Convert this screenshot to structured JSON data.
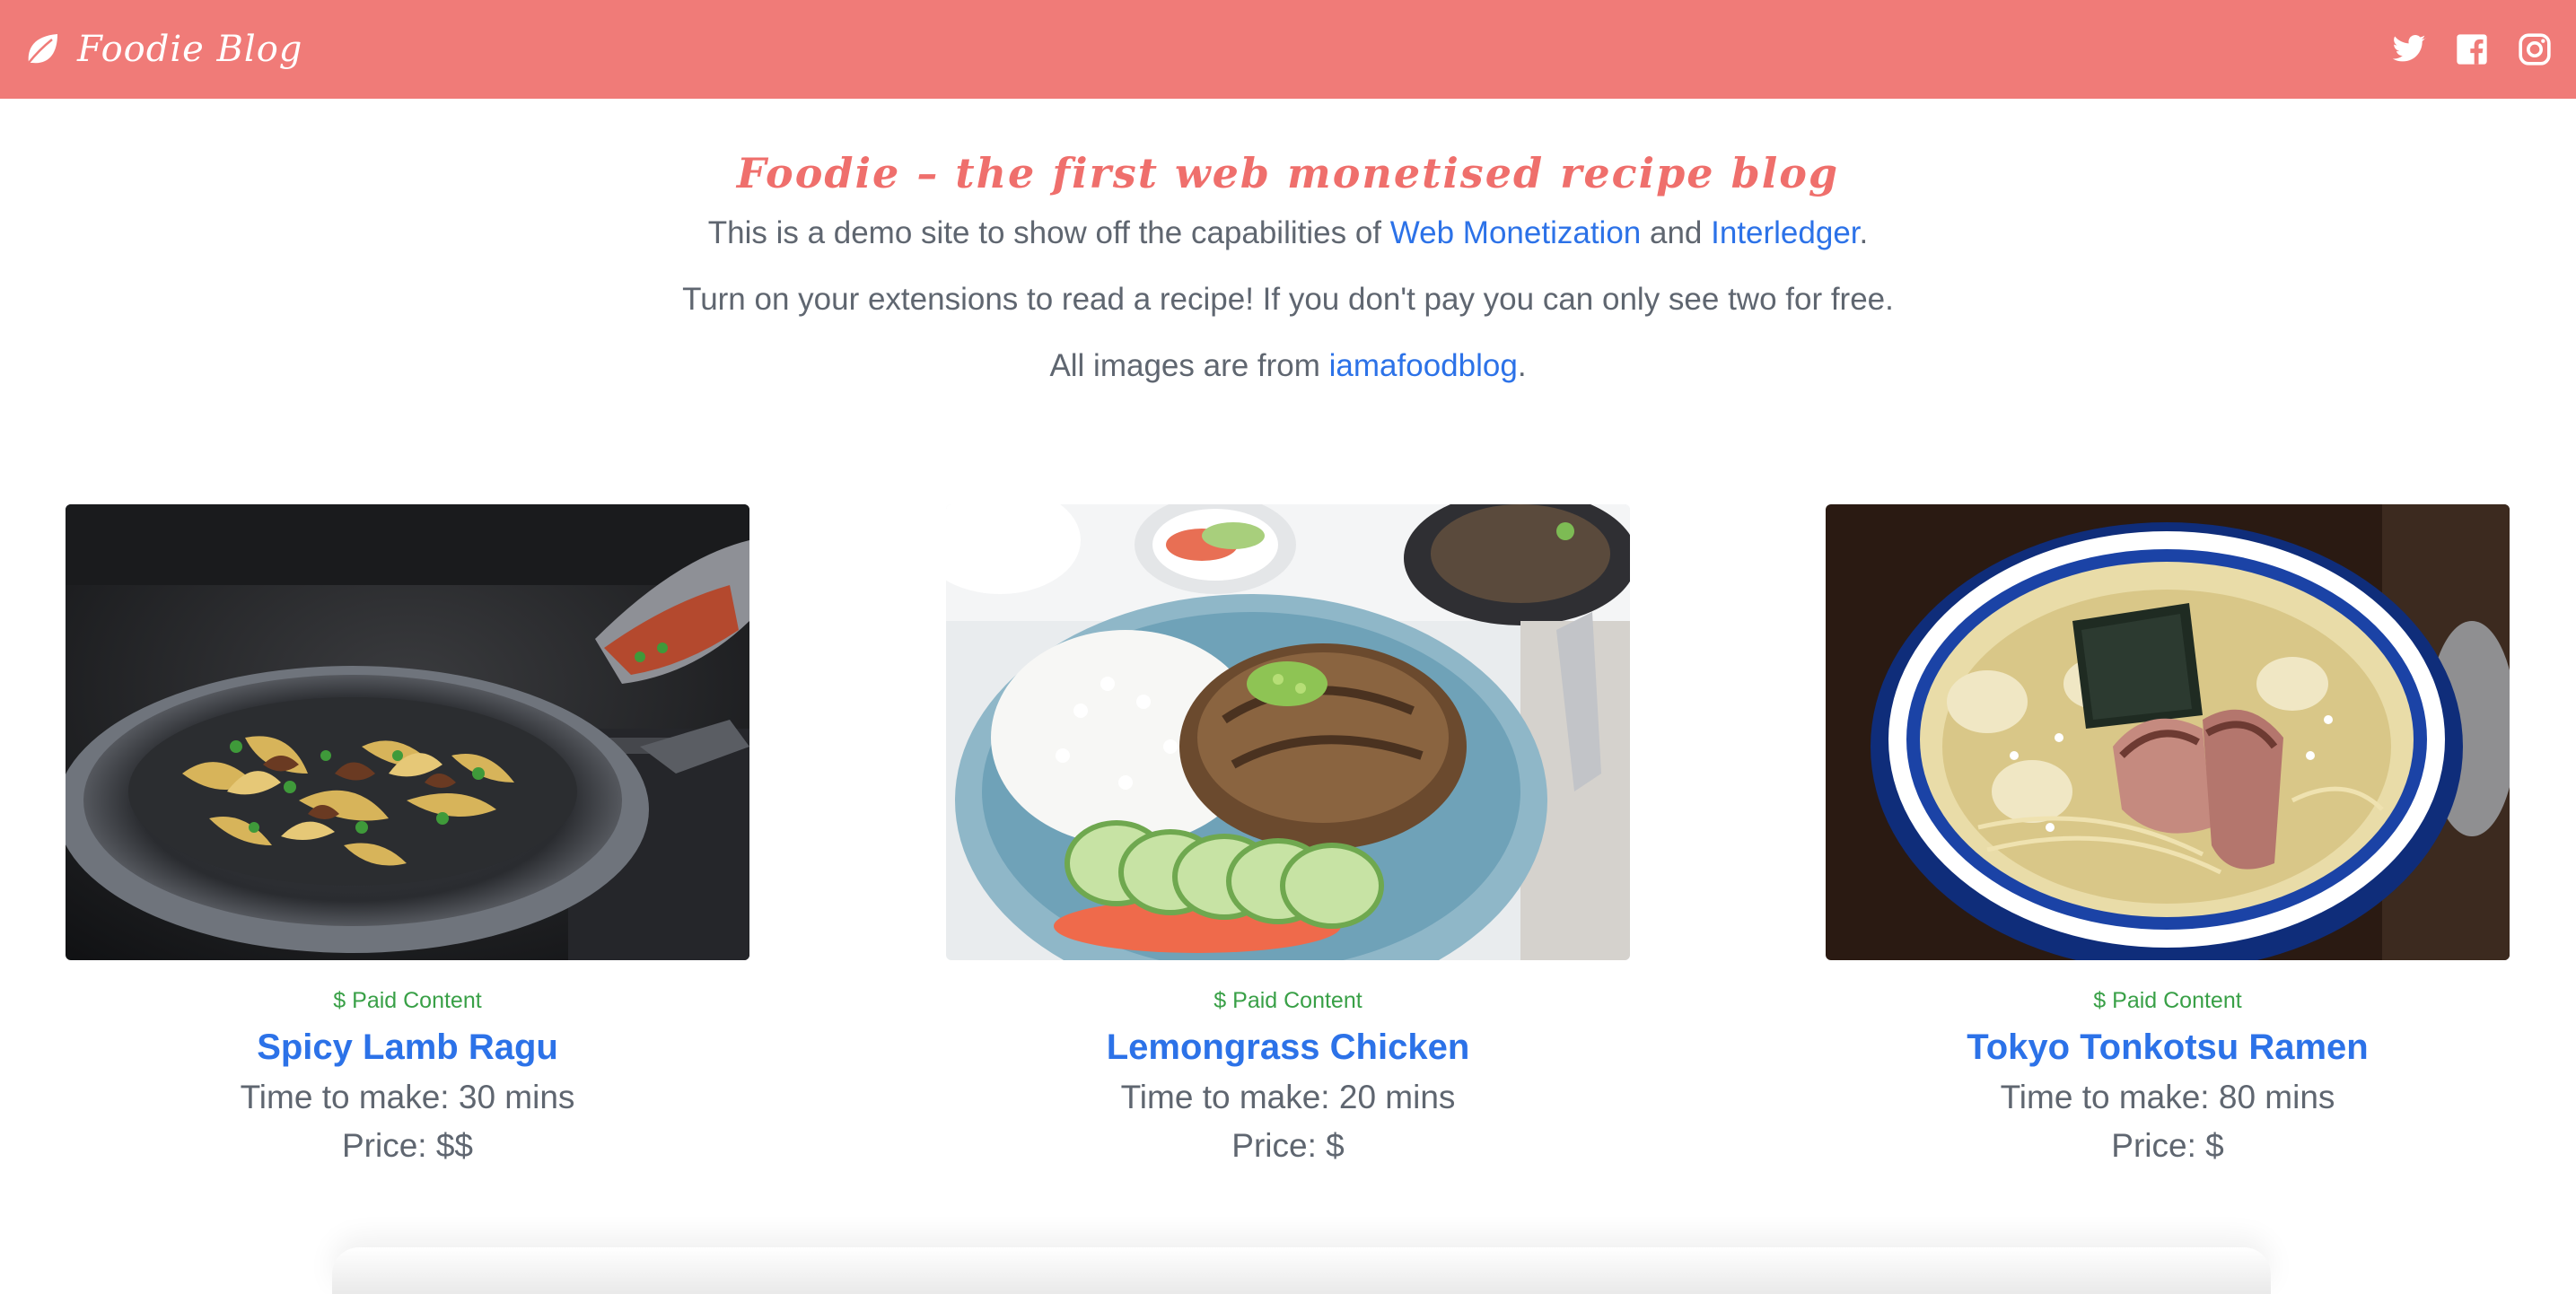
{
  "header": {
    "brand": "Foodie Blog",
    "icons": [
      "leaf-icon",
      "twitter-icon",
      "facebook-icon",
      "instagram-icon"
    ],
    "colors": {
      "bar": "#f07b78",
      "text": "#ffffff"
    }
  },
  "hero": {
    "title": "Foodie – the first web monetised recipe blog",
    "line1_prefix": "This is a demo site to show off the capabilities of ",
    "line1_link1": "Web Monetization",
    "line1_middle": " and ",
    "line1_link2": "Interledger",
    "line1_suffix": ".",
    "line2": "Turn on your extensions to read a recipe! If you don't pay you can only see two for free.",
    "line3_prefix": "All images are from ",
    "line3_link": "iamafoodblog",
    "line3_suffix": "."
  },
  "recipes": [
    {
      "badge": "$ Paid Content",
      "title": "Spicy Lamb Ragu",
      "time": "Time to make: 30 mins",
      "price": "Price: $$"
    },
    {
      "badge": "$ Paid Content",
      "title": "Lemongrass Chicken",
      "time": "Time to make: 20 mins",
      "price": "Price: $"
    },
    {
      "badge": "$ Paid Content",
      "title": "Tokyo Tonkotsu Ramen",
      "time": "Time to make: 80 mins",
      "price": "Price: $"
    }
  ],
  "colors": {
    "link": "#2c72e8",
    "paid": "#39a047",
    "accent": "#ef6f6c",
    "body_text": "#5f6670"
  }
}
